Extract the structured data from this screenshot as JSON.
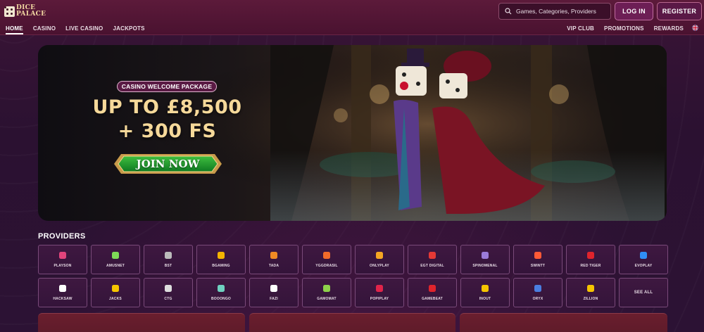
{
  "logo": {
    "line1": "DICE",
    "line2": "PALACE"
  },
  "search": {
    "placeholder": "Games, Categories, Providers"
  },
  "auth": {
    "login_label": "LOG IN",
    "register_label": "REGISTER"
  },
  "nav": {
    "left": [
      "HOME",
      "CASINO",
      "LIVE CASINO",
      "JACKPOTS"
    ],
    "right": [
      "VIP CLUB",
      "PROMOTIONS",
      "REWARDS"
    ]
  },
  "hero": {
    "badge": "CASINO WELCOME PACKAGE",
    "line1": "UP TO £8,500",
    "line2": "+ 300 FS",
    "cta": "JOIN NOW"
  },
  "providers": {
    "title": "PROVIDERS",
    "items": [
      {
        "name": "PLAYSON",
        "icon": "playson-icon",
        "color": "#e0447c"
      },
      {
        "name": "AMUSNET",
        "icon": "amusnet-icon",
        "color": "#7ed957"
      },
      {
        "name": "BST",
        "icon": "bst-icon",
        "color": "#bbbbbb"
      },
      {
        "name": "BGAMING",
        "icon": "bgaming-icon",
        "color": "#f4b400"
      },
      {
        "name": "TADA",
        "icon": "tada-icon",
        "color": "#f08a24"
      },
      {
        "name": "YGGDRASIL",
        "icon": "yggdrasil-icon",
        "color": "#f26b2a"
      },
      {
        "name": "ONLYPLAY",
        "icon": "onlyplay-icon",
        "color": "#f5a623"
      },
      {
        "name": "EGT DIGITAL",
        "icon": "egt-digital-icon",
        "color": "#e53935"
      },
      {
        "name": "SPINOMENAL",
        "icon": "spinomenal-icon",
        "color": "#9b7bd8"
      },
      {
        "name": "SWINTT",
        "icon": "swintt-icon",
        "color": "#ff5a36"
      },
      {
        "name": "RED TIGER",
        "icon": "red-tiger-icon",
        "color": "#e0242c"
      },
      {
        "name": "EVOPLAY",
        "icon": "evoplay-icon",
        "color": "#2f8ef5"
      },
      {
        "name": "HACKSAW",
        "icon": "hacksaw-icon",
        "color": "#ffffff"
      },
      {
        "name": "JACKS",
        "icon": "jacks-icon",
        "color": "#f5c400"
      },
      {
        "name": "CTG",
        "icon": "ctg-icon",
        "color": "#dddddd"
      },
      {
        "name": "BOOONGO",
        "icon": "booongo-icon",
        "color": "#6fd0c0"
      },
      {
        "name": "FAZI",
        "icon": "fazi-icon",
        "color": "#ffffff"
      },
      {
        "name": "GAMOMAT",
        "icon": "gamomat-icon",
        "color": "#8ed14b"
      },
      {
        "name": "POPIPLAY",
        "icon": "popiplay-icon",
        "color": "#e0244a"
      },
      {
        "name": "GAMEBEAT",
        "icon": "gamebeat-icon",
        "color": "#e0242c"
      },
      {
        "name": "INOUT",
        "icon": "inout-icon",
        "color": "#f5c400"
      },
      {
        "name": "ORYX",
        "icon": "oryx-icon",
        "color": "#4a7ee0"
      },
      {
        "name": "ZILLION",
        "icon": "zillion-icon",
        "color": "#f5c400"
      }
    ],
    "see_all": "SEE ALL"
  }
}
